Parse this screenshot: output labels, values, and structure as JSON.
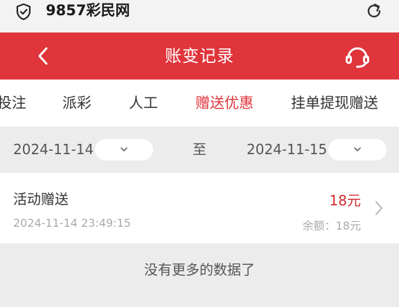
{
  "browser": {
    "site_title": "9857彩民网",
    "icons": [
      "shield-icon",
      "refresh-icon"
    ]
  },
  "header": {
    "title": "账变记录",
    "icons": [
      "back-icon",
      "headset-icon"
    ]
  },
  "tabs": [
    {
      "label": "投注",
      "active": false
    },
    {
      "label": "派彩",
      "active": false
    },
    {
      "label": "人工",
      "active": false
    },
    {
      "label": "赠送优惠",
      "active": true
    },
    {
      "label": "挂单提现赠送",
      "active": false
    }
  ],
  "date_filter": {
    "start_date": "2024-11-14",
    "to_label": "至",
    "end_date": "2024-11-15"
  },
  "records": [
    {
      "title": "活动赠送",
      "time": "2024-11-14 23:49:15",
      "amount": "18元",
      "balance": "余额：18元"
    }
  ],
  "footer": {
    "no_more": "没有更多的数据了"
  },
  "colors": {
    "accent": "#e0353b",
    "amount": "#d42a2f",
    "background": "#ececec"
  }
}
